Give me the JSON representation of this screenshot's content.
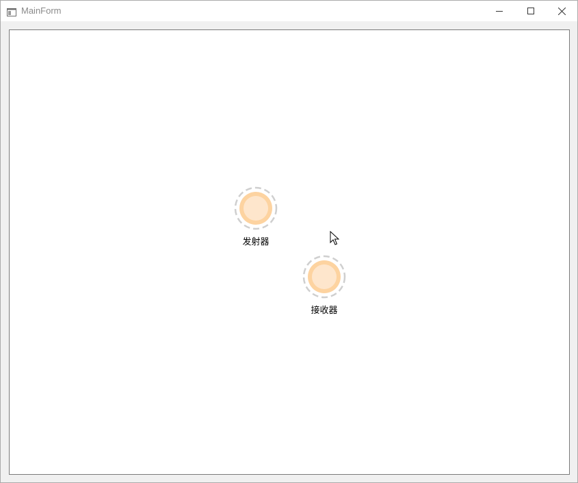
{
  "window": {
    "title": "MainForm",
    "controls": {
      "minimize_icon": "minimize-icon",
      "maximize_icon": "maximize-icon",
      "close_icon": "close-icon"
    }
  },
  "canvas": {
    "nodes": [
      {
        "label": "发射器"
      },
      {
        "label": "接收器"
      }
    ]
  },
  "colors": {
    "node_fill_outer": "#fdd3a0",
    "node_fill_inner": "#fee6cc",
    "node_ring_dash": "#cfcfcf",
    "canvas_border": "#7a7a7a",
    "window_bg": "#f0f0f0"
  }
}
